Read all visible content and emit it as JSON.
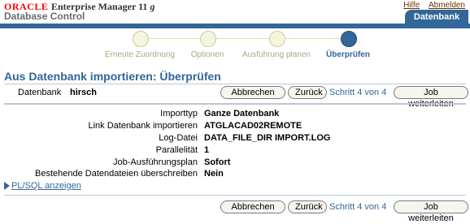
{
  "header": {
    "brand": "ORACLE",
    "product": "Enterprise Manager 11",
    "product_suffix": "g",
    "subtitle": "Database Control",
    "links": [
      "Hilfe",
      "Abmelden"
    ],
    "tab": "Datenbank"
  },
  "train": {
    "steps": [
      {
        "label": "Erneute Zuordnung",
        "active": false
      },
      {
        "label": "Optionen",
        "active": false
      },
      {
        "label": "Ausführung planen",
        "active": false
      },
      {
        "label": "Überprüfen",
        "active": true
      }
    ]
  },
  "page": {
    "title": "Aus Datenbank importieren: Überprüfen",
    "db_label": "Datenbank",
    "db_value": "hirsch"
  },
  "nav": {
    "cancel": "Abbrechen",
    "back": "Zurück",
    "back_access": "Z",
    "step_info": "Schritt 4 von 4",
    "next": "Job weiterleiten"
  },
  "details": [
    {
      "label": "Importtyp",
      "value": "Ganze Datenbank"
    },
    {
      "label": "Link Datenbank importieren",
      "value": "ATGLACAD02REMOTE"
    },
    {
      "label": "Log-Datei",
      "value": "DATA_FILE_DIR IMPORT.LOG"
    },
    {
      "label": "Parallelität",
      "value": "1"
    },
    {
      "label": "Job-Ausführungsplan",
      "value": "Sofort"
    },
    {
      "label": "Bestehende Datendateien überschreiben",
      "value": "Nein"
    }
  ],
  "plsql_toggle": "PL/SQL anzeigen",
  "colors": {
    "accent": "#336699",
    "brand": "#ff0000",
    "train_inactive": "#f5f5dc"
  }
}
